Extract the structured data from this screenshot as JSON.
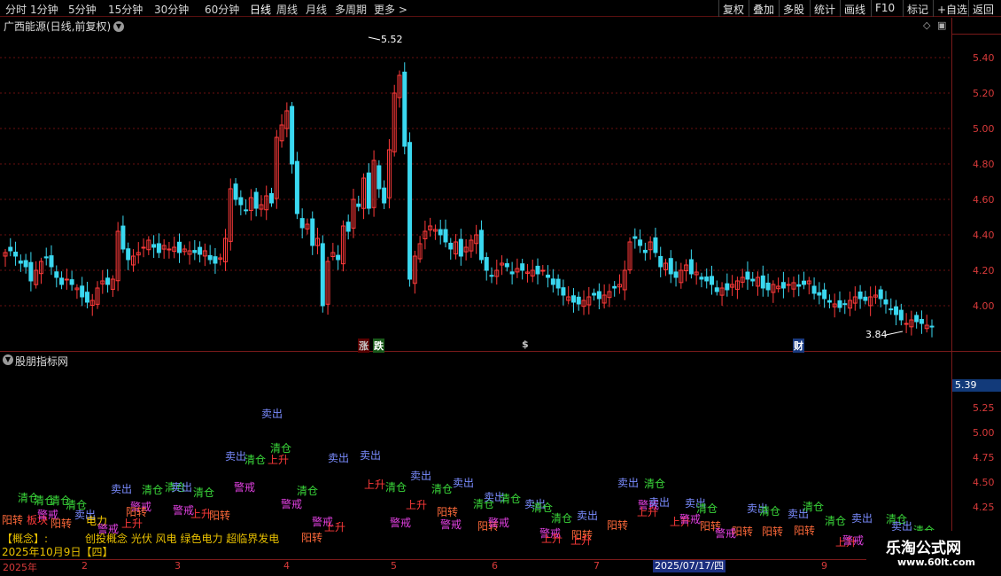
{
  "toolbar": {
    "periods": [
      "分时",
      "1分钟",
      "5分钟",
      "15分钟",
      "30分钟",
      "60分钟",
      "日线",
      "周线",
      "月线",
      "多周期",
      "更多 >"
    ],
    "active_period": "日线",
    "right_buttons": [
      "复权",
      "叠加",
      "多股",
      "统计",
      "画线",
      "F10",
      "标记",
      "+自选",
      "返回"
    ]
  },
  "main_chart": {
    "title": "广西能源(日线,前复权)",
    "price_labels": [
      "5.40",
      "5.20",
      "5.00",
      "4.80",
      "4.60",
      "4.40",
      "4.20",
      "4.00"
    ],
    "high_annotation": "5.52",
    "low_annotation": "3.84",
    "markers": [
      {
        "text": "涨",
        "color": "#ff3030"
      },
      {
        "text": "跌",
        "color": "#30d030"
      },
      {
        "text": "$",
        "color": "#ff3030"
      },
      {
        "text": "财",
        "color": "#4a8cff"
      }
    ]
  },
  "sub_chart": {
    "title": "股朋指标网",
    "current_value": "5.39",
    "labels": [
      "5.25",
      "5.00",
      "4.75",
      "4.50",
      "4.25"
    ],
    "signal_colors": {
      "卖出": "#7a8cff",
      "清仓": "#3ad83a",
      "上升": "#ff3a3a",
      "警戒": "#e040e0",
      "阳转": "#ff6a3a"
    }
  },
  "info": {
    "concept_key": "【概念】:",
    "concept_value": "创投概念 光伏 风电 绿色电力 超临界发电",
    "date": "2025年10月9日【四】"
  },
  "time_axis": {
    "labels": [
      "2025年",
      "2",
      "3",
      "4",
      "5",
      "6",
      "7",
      "9"
    ],
    "cursor_date": "2025/07/17/四"
  },
  "watermark": {
    "main": "乐淘公式网",
    "sub": "www.60lt.com"
  },
  "chart_data": {
    "type": "candlestick",
    "title": "广西能源(日线,前复权)",
    "y_range": [
      3.8,
      5.6
    ],
    "ticks": [
      4.0,
      4.2,
      4.4,
      4.6,
      4.8,
      5.0,
      5.2,
      5.4
    ],
    "period_highest": 5.52,
    "period_lowest": 3.84,
    "closes": [
      4.3,
      4.31,
      4.28,
      4.24,
      4.22,
      4.14,
      4.2,
      4.25,
      4.27,
      4.22,
      4.16,
      4.12,
      4.15,
      4.12,
      4.1,
      4.05,
      4.02,
      4.03,
      4.1,
      4.14,
      4.12,
      4.15,
      4.42,
      4.32,
      4.26,
      4.28,
      4.3,
      4.33,
      4.37,
      4.33,
      4.3,
      4.34,
      4.32,
      4.33,
      4.3,
      4.32,
      4.31,
      4.3,
      4.29,
      4.31,
      4.26,
      4.24,
      4.27,
      4.38,
      4.66,
      4.6,
      4.57,
      4.54,
      4.61,
      4.55,
      4.57,
      4.62,
      4.58,
      4.95,
      5.02,
      5.1,
      4.8,
      4.52,
      4.44,
      4.46,
      4.34,
      4.38,
      4.0,
      4.25,
      4.3,
      4.26,
      4.45,
      4.42,
      4.6,
      4.56,
      4.72,
      4.55,
      4.82,
      4.66,
      4.58,
      4.88,
      5.2,
      5.3,
      4.9,
      4.15,
      4.28,
      4.35,
      4.42,
      4.45,
      4.43,
      4.4,
      4.36,
      4.32,
      4.36,
      4.28,
      4.33,
      4.37,
      4.4,
      4.26,
      4.2,
      4.17,
      4.2,
      4.24,
      4.22,
      4.18,
      4.21,
      4.2,
      4.19,
      4.2,
      4.18,
      4.2,
      4.16,
      4.12,
      4.1,
      4.06,
      4.05,
      4.02,
      4.01,
      4.03,
      4.05,
      4.06,
      4.04,
      4.06,
      4.08,
      4.1,
      4.12,
      4.2,
      4.36,
      4.38,
      4.34,
      4.3,
      4.36,
      4.3,
      4.22,
      4.24,
      4.18,
      4.16,
      4.2,
      4.23,
      4.18,
      4.19,
      4.15,
      4.14,
      4.12,
      4.08,
      4.1,
      4.09,
      4.12,
      4.14,
      4.16,
      4.15,
      4.14,
      4.16,
      4.1,
      4.09,
      4.12,
      4.11,
      4.1,
      4.12,
      4.13,
      4.11,
      4.12,
      4.14,
      4.07,
      4.06,
      4.04,
      4.02,
      4.01,
      3.99,
      4.01,
      4.03,
      4.05,
      4.04,
      4.03,
      4.05,
      4.06,
      4.04,
      4.01,
      3.98,
      3.95,
      3.92,
      3.9,
      3.92,
      3.91,
      3.9,
      3.89,
      3.88
    ]
  }
}
